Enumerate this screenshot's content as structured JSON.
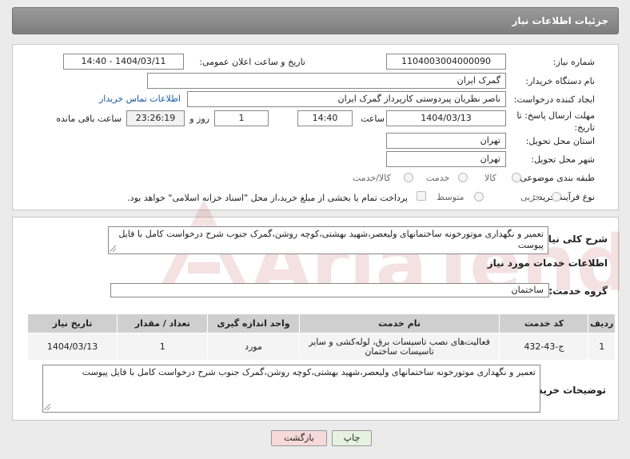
{
  "header": {
    "title": "جزئیات اطلاعات نیاز"
  },
  "fields": {
    "need_number": {
      "label": "شماره نیاز:",
      "value": "1104003004000090"
    },
    "announce_datetime": {
      "label": "تاریخ و ساعت اعلان عمومی:",
      "value": "1404/03/11 - 14:40"
    },
    "buyer_org": {
      "label": "نام دستگاه خریدار:",
      "value": "گمرک ایران"
    },
    "creator": {
      "label": "ایجاد کننده درخواست:",
      "value": "ناصر نظریان پیردوستی کارپرداز گمرک ایران"
    },
    "buyer_contact_link": "اطلاعات تماس خریدار",
    "deadline": {
      "label": "مهلت ارسال پاسخ: تا تاریخ:",
      "date": "1404/03/13",
      "time_label": "ساعت",
      "time": "14:40",
      "days": "1",
      "days_label": "روز و",
      "remaining": "23:26:19",
      "remaining_label": "ساعت باقی مانده"
    },
    "province": {
      "label": "استان محل تحویل:",
      "value": "تهران"
    },
    "city": {
      "label": "شهر محل تحویل:",
      "value": "تهران"
    },
    "category": {
      "label": "طبقه بندی موضوعی:",
      "options": [
        "کالا",
        "خدمت",
        "کالا/خدمت"
      ]
    },
    "process_type": {
      "label": "نوع فرآیند خرید :",
      "options": [
        "جزیی",
        "متوسط"
      ],
      "payment_note": "پرداخت تمام یا بخشی از مبلغ خرید،از محل \"اسناد خزانه اسلامی\" خواهد بود."
    }
  },
  "summary": {
    "label": "شرح کلی نیاز:",
    "text": "تعمیر و نگهداری موتورخونه ساختمانهای ولیعصر،شهید بهشتی،کوچه روشن،گمرک جنوب شرح درخواست کامل با فایل پیوست"
  },
  "services": {
    "section_title": "اطلاعات خدمات مورد نیاز",
    "group_label": "گروه خدمت:",
    "group_value": "ساختمان",
    "columns": [
      "ردیف",
      "کد خدمت",
      "نام خدمت",
      "واحد اندازه گیری",
      "تعداد / مقدار",
      "تاریخ نیاز"
    ],
    "rows": [
      {
        "index": "1",
        "code": "ج-43-432",
        "name": "فعالیت‌های نصب تاسیسات برق، لوله‌کشی و سایر تاسیسات ساختمان",
        "unit": "مورد",
        "qty": "1",
        "date": "1404/03/13"
      }
    ]
  },
  "buyer_notes": {
    "label": "توضیحات خریدار:",
    "text": "تعمیر و نگهداری موتورخونه ساختمانهای ولیعصر،شهید بهشتی،کوچه روشن،گمرک جنوب شرح درخواست کامل با فایل پیوست"
  },
  "buttons": {
    "print": "چاپ",
    "back": "بازگشت"
  },
  "watermark": {
    "text": "AriaTender.net"
  },
  "colors": {
    "header": "#8a8a8a",
    "link": "#1a5aa6",
    "back_button": "#f7d9d9",
    "print_button": "#e6f2e0"
  }
}
